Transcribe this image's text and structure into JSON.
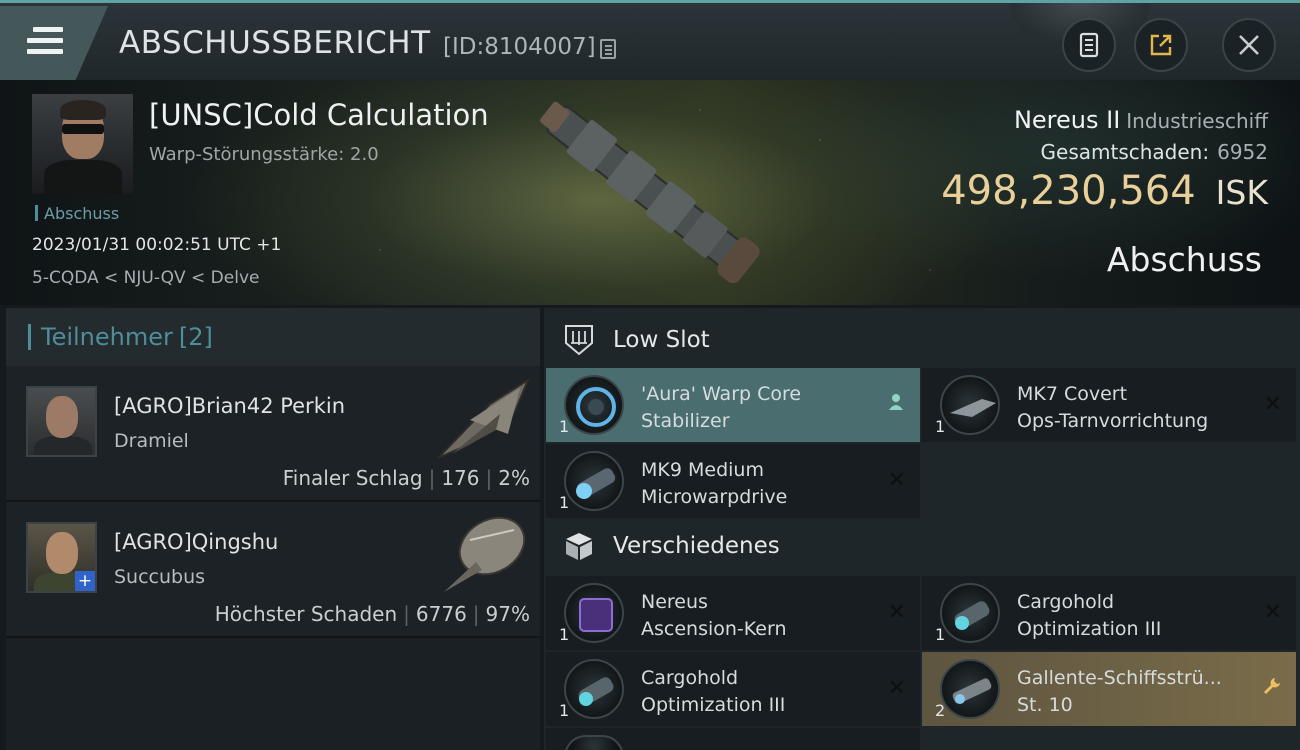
{
  "header": {
    "title": "ABSCHUSSBERICHT",
    "id_label": "[ID:8104007]",
    "icons": [
      "menu-icon",
      "copy-icon",
      "clipboard-icon",
      "share-icon",
      "close-icon"
    ]
  },
  "victim": {
    "name": "[UNSC]Cold Calculation",
    "warp_disruption": "Warp-Störungsstärke: 2.0",
    "kill_tag": "Abschuss",
    "datetime": "2023/01/31 00:02:51 UTC +1",
    "location": "5-CQDA < NJU-QV < Delve",
    "ship_name": "Nereus II",
    "ship_class": "Industrieschiff",
    "damage_label": "Gesamtschaden:",
    "damage_value": "6952",
    "isk_value": "498,230,564",
    "isk_unit": "ISK",
    "result": "Abschuss"
  },
  "participants": {
    "label": "Teilnehmer",
    "count": "[2]",
    "list": [
      {
        "name": "[AGRO]Brian42 Perkin",
        "ship": "Dramiel",
        "role": "Finaler Schlag",
        "damage": "176",
        "percent": "2%"
      },
      {
        "name": "[AGRO]Qingshu",
        "ship": "Succubus",
        "role": "Höchster Schaden",
        "damage": "6776",
        "percent": "97%"
      }
    ]
  },
  "fitting": {
    "low_slot_label": "Low Slot",
    "misc_label": "Verschiedenes",
    "low_slot": [
      {
        "qty": "1",
        "line1": "'Aura' Warp Core",
        "line2": "Stabilizer",
        "status": "dropped"
      },
      {
        "qty": "1",
        "line1": "MK7 Covert",
        "line2": "Ops-Tarnvorrichtung",
        "status": "destroyed"
      },
      {
        "qty": "1",
        "line1": "MK9 Medium",
        "line2": "Microwarpdrive",
        "status": "destroyed"
      }
    ],
    "misc": [
      {
        "qty": "1",
        "line1": "Nereus",
        "line2": "Ascension-Kern",
        "status": "destroyed"
      },
      {
        "qty": "1",
        "line1": "Cargohold",
        "line2": "Optimization III",
        "status": "destroyed"
      },
      {
        "qty": "1",
        "line1": "Cargohold",
        "line2": "Optimization III",
        "status": "destroyed"
      },
      {
        "qty": "2",
        "line1": "Gallente-Schiffsstrü...",
        "line2": "St. 10",
        "status": "skill"
      }
    ]
  },
  "colors": {
    "accent": "#4f8d98",
    "isk": "#e9d09a",
    "highlight": "#4a6e70",
    "gold": "#7a6c4a"
  }
}
